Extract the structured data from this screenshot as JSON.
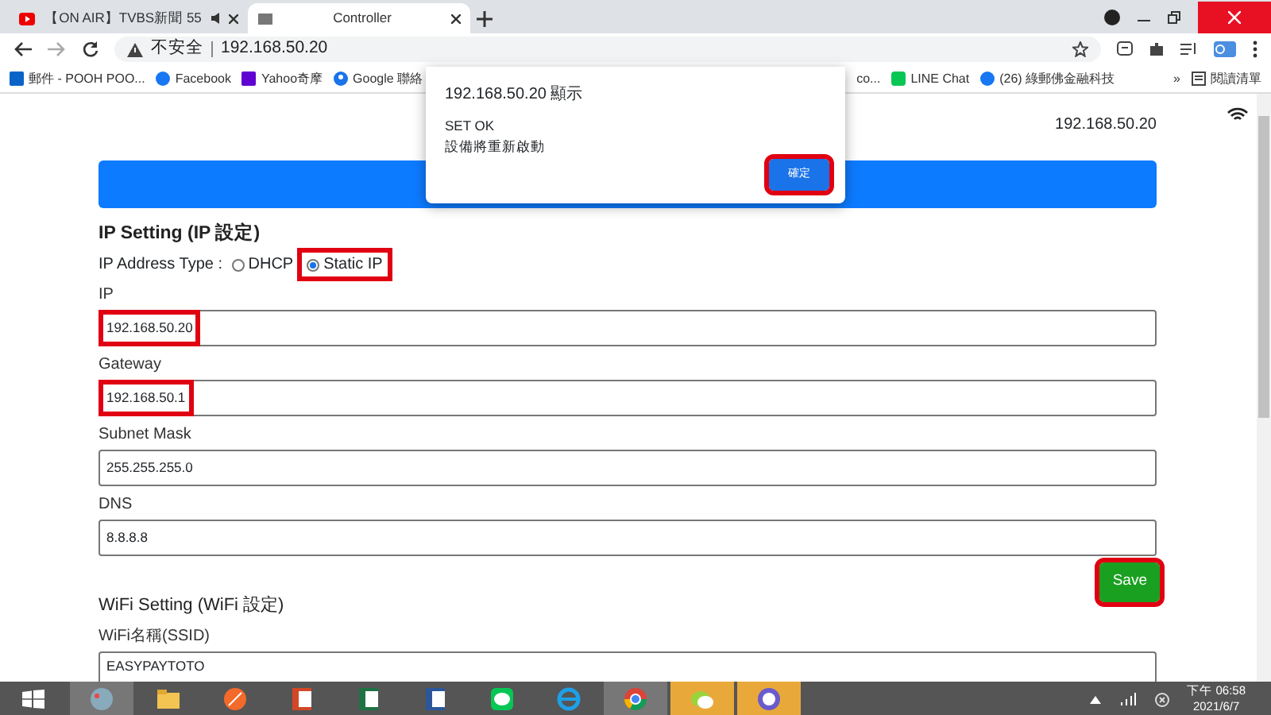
{
  "tabs": [
    {
      "title": "【ON AIR】TVBS新聞 55",
      "selected": false,
      "audio": true
    },
    {
      "title": "Controller",
      "selected": true,
      "audio": false
    }
  ],
  "address": {
    "security": "不安全",
    "url": "192.168.50.20"
  },
  "bookmarks_left": [
    {
      "label": "郵件 - POOH POO..."
    },
    {
      "label": "Facebook"
    },
    {
      "label": "Yahoo奇摩"
    },
    {
      "label": "Google 聯絡"
    }
  ],
  "bookmarks_right": [
    {
      "label": "co..."
    },
    {
      "label": "LINE Chat"
    },
    {
      "label": "(26) 綠郵佛金融科技"
    }
  ],
  "more": "»",
  "reading_list": "閱讀清單",
  "page": {
    "host": "192.168.50.20",
    "ip_section": {
      "title": "IP Setting (IP 設定)",
      "type_label": "IP Address Type :",
      "options": [
        {
          "label": "DHCP",
          "selected": false,
          "highlighted": false
        },
        {
          "label": "Static IP",
          "selected": true,
          "highlighted": true
        }
      ],
      "fields": [
        {
          "label": "IP",
          "value": "192.168.50.20",
          "highlighted": true
        },
        {
          "label": "Gateway",
          "value": "192.168.50.1",
          "highlighted": true
        },
        {
          "label": "Subnet Mask",
          "value": "255.255.255.0",
          "highlighted": false
        },
        {
          "label": "DNS",
          "value": "8.8.8.8",
          "highlighted": false
        }
      ],
      "save": {
        "label": "Save",
        "highlighted": true
      }
    },
    "wifi_section": {
      "title": "WiFi Setting (WiFi 設定)",
      "fields": [
        {
          "label": "WiFi名稱(SSID)",
          "value": "EASYPAYTOTO",
          "highlighted": false
        }
      ]
    }
  },
  "dialog": {
    "title": "192.168.50.20 顯示",
    "lines": [
      "SET OK",
      "設備將重新啟動"
    ],
    "button": {
      "label": "確定",
      "highlighted": true
    }
  },
  "taskbar": {
    "time": "下午 06:58",
    "date": "2021/6/7"
  }
}
